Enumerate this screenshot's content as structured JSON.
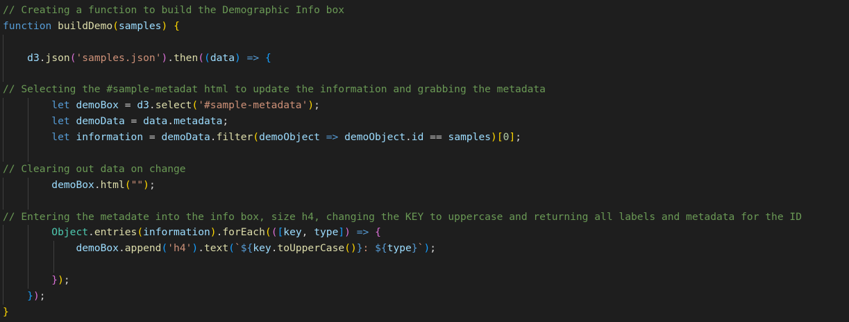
{
  "lines": [
    [
      {
        "c": "c",
        "t": "// Creating a function to build the Demographic Info box"
      }
    ],
    [
      {
        "c": "k",
        "t": "function"
      },
      {
        "c": "p",
        "t": " "
      },
      {
        "c": "f",
        "t": "buildDemo"
      },
      {
        "c": "b1",
        "t": "("
      },
      {
        "c": "v",
        "t": "samples"
      },
      {
        "c": "b1",
        "t": ")"
      },
      {
        "c": "p",
        "t": " "
      },
      {
        "c": "b1",
        "t": "{"
      }
    ],
    [],
    [
      {
        "c": "p",
        "t": "    "
      },
      {
        "c": "v",
        "t": "d3"
      },
      {
        "c": "p",
        "t": "."
      },
      {
        "c": "f",
        "t": "json"
      },
      {
        "c": "b2",
        "t": "("
      },
      {
        "c": "s",
        "t": "'samples.json'"
      },
      {
        "c": "b2",
        "t": ")"
      },
      {
        "c": "p",
        "t": "."
      },
      {
        "c": "f",
        "t": "then"
      },
      {
        "c": "b2",
        "t": "("
      },
      {
        "c": "b3",
        "t": "("
      },
      {
        "c": "v",
        "t": "data"
      },
      {
        "c": "b3",
        "t": ")"
      },
      {
        "c": "p",
        "t": " "
      },
      {
        "c": "k",
        "t": "=>"
      },
      {
        "c": "p",
        "t": " "
      },
      {
        "c": "b3",
        "t": "{"
      }
    ],
    [],
    [
      {
        "c": "c",
        "t": "// Selecting the #sample-metadat html to update the information and grabbing the metadata"
      }
    ],
    [
      {
        "c": "p",
        "t": "        "
      },
      {
        "c": "k",
        "t": "let"
      },
      {
        "c": "p",
        "t": " "
      },
      {
        "c": "v",
        "t": "demoBox"
      },
      {
        "c": "p",
        "t": " = "
      },
      {
        "c": "v",
        "t": "d3"
      },
      {
        "c": "p",
        "t": "."
      },
      {
        "c": "f",
        "t": "select"
      },
      {
        "c": "b1",
        "t": "("
      },
      {
        "c": "s",
        "t": "'#sample-metadata'"
      },
      {
        "c": "b1",
        "t": ")"
      },
      {
        "c": "p",
        "t": ";"
      }
    ],
    [
      {
        "c": "p",
        "t": "        "
      },
      {
        "c": "k",
        "t": "let"
      },
      {
        "c": "p",
        "t": " "
      },
      {
        "c": "v",
        "t": "demoData"
      },
      {
        "c": "p",
        "t": " = "
      },
      {
        "c": "v",
        "t": "data"
      },
      {
        "c": "p",
        "t": "."
      },
      {
        "c": "v",
        "t": "metadata"
      },
      {
        "c": "p",
        "t": ";"
      }
    ],
    [
      {
        "c": "p",
        "t": "        "
      },
      {
        "c": "k",
        "t": "let"
      },
      {
        "c": "p",
        "t": " "
      },
      {
        "c": "v",
        "t": "information"
      },
      {
        "c": "p",
        "t": " = "
      },
      {
        "c": "v",
        "t": "demoData"
      },
      {
        "c": "p",
        "t": "."
      },
      {
        "c": "f",
        "t": "filter"
      },
      {
        "c": "b1",
        "t": "("
      },
      {
        "c": "v",
        "t": "demoObject"
      },
      {
        "c": "p",
        "t": " "
      },
      {
        "c": "k",
        "t": "=>"
      },
      {
        "c": "p",
        "t": " "
      },
      {
        "c": "v",
        "t": "demoObject"
      },
      {
        "c": "p",
        "t": "."
      },
      {
        "c": "v",
        "t": "id"
      },
      {
        "c": "p",
        "t": " == "
      },
      {
        "c": "v",
        "t": "samples"
      },
      {
        "c": "b1",
        "t": ")"
      },
      {
        "c": "b1",
        "t": "["
      },
      {
        "c": "n",
        "t": "0"
      },
      {
        "c": "b1",
        "t": "]"
      },
      {
        "c": "p",
        "t": ";"
      }
    ],
    [],
    [
      {
        "c": "c",
        "t": "// Clearing out data on change"
      }
    ],
    [
      {
        "c": "p",
        "t": "        "
      },
      {
        "c": "v",
        "t": "demoBox"
      },
      {
        "c": "p",
        "t": "."
      },
      {
        "c": "f",
        "t": "html"
      },
      {
        "c": "b1",
        "t": "("
      },
      {
        "c": "s",
        "t": "\"\""
      },
      {
        "c": "b1",
        "t": ")"
      },
      {
        "c": "p",
        "t": ";"
      }
    ],
    [],
    [
      {
        "c": "c",
        "t": "// Entering the metadate into the info box, size h4, changing the KEY to uppercase and returning all labels and metadata for the ID"
      }
    ],
    [
      {
        "c": "p",
        "t": "        "
      },
      {
        "c": "t",
        "t": "Object"
      },
      {
        "c": "p",
        "t": "."
      },
      {
        "c": "f",
        "t": "entries"
      },
      {
        "c": "b1",
        "t": "("
      },
      {
        "c": "v",
        "t": "information"
      },
      {
        "c": "b1",
        "t": ")"
      },
      {
        "c": "p",
        "t": "."
      },
      {
        "c": "f",
        "t": "forEach"
      },
      {
        "c": "b1",
        "t": "("
      },
      {
        "c": "b2",
        "t": "("
      },
      {
        "c": "b3",
        "t": "["
      },
      {
        "c": "v",
        "t": "key"
      },
      {
        "c": "p",
        "t": ", "
      },
      {
        "c": "v",
        "t": "type"
      },
      {
        "c": "b3",
        "t": "]"
      },
      {
        "c": "b2",
        "t": ")"
      },
      {
        "c": "p",
        "t": " "
      },
      {
        "c": "k",
        "t": "=>"
      },
      {
        "c": "p",
        "t": " "
      },
      {
        "c": "b2",
        "t": "{"
      }
    ],
    [
      {
        "c": "p",
        "t": "            "
      },
      {
        "c": "v",
        "t": "demoBox"
      },
      {
        "c": "p",
        "t": "."
      },
      {
        "c": "f",
        "t": "append"
      },
      {
        "c": "b3",
        "t": "("
      },
      {
        "c": "s",
        "t": "'h4'"
      },
      {
        "c": "b3",
        "t": ")"
      },
      {
        "c": "p",
        "t": "."
      },
      {
        "c": "f",
        "t": "text"
      },
      {
        "c": "b3",
        "t": "("
      },
      {
        "c": "s",
        "t": "`"
      },
      {
        "c": "k",
        "t": "${"
      },
      {
        "c": "v",
        "t": "key"
      },
      {
        "c": "p",
        "t": "."
      },
      {
        "c": "f",
        "t": "toUpperCase"
      },
      {
        "c": "b1",
        "t": "()"
      },
      {
        "c": "k",
        "t": "}"
      },
      {
        "c": "s",
        "t": ": "
      },
      {
        "c": "k",
        "t": "${"
      },
      {
        "c": "v",
        "t": "type"
      },
      {
        "c": "k",
        "t": "}"
      },
      {
        "c": "s",
        "t": "`"
      },
      {
        "c": "b3",
        "t": ")"
      },
      {
        "c": "p",
        "t": ";"
      }
    ],
    [],
    [
      {
        "c": "p",
        "t": "        "
      },
      {
        "c": "b2",
        "t": "}"
      },
      {
        "c": "b1",
        "t": ")"
      },
      {
        "c": "p",
        "t": ";"
      }
    ],
    [
      {
        "c": "p",
        "t": "    "
      },
      {
        "c": "b3",
        "t": "}"
      },
      {
        "c": "b2",
        "t": ")"
      },
      {
        "c": "p",
        "t": ";"
      }
    ],
    [
      {
        "c": "b1",
        "t": "}"
      }
    ]
  ],
  "guides": [
    [],
    [],
    [
      "g1"
    ],
    [
      "g1"
    ],
    [
      "g1"
    ],
    [],
    [
      "g1",
      "g2"
    ],
    [
      "g1",
      "g2"
    ],
    [
      "g1",
      "g2"
    ],
    [
      "g1",
      "g2"
    ],
    [],
    [
      "g1",
      "g2"
    ],
    [
      "g1",
      "g2"
    ],
    [],
    [
      "g1",
      "g2"
    ],
    [
      "g1",
      "g2",
      "g3"
    ],
    [
      "g1",
      "g2",
      "g3"
    ],
    [
      "g1",
      "g2"
    ],
    [
      "g1"
    ],
    []
  ]
}
